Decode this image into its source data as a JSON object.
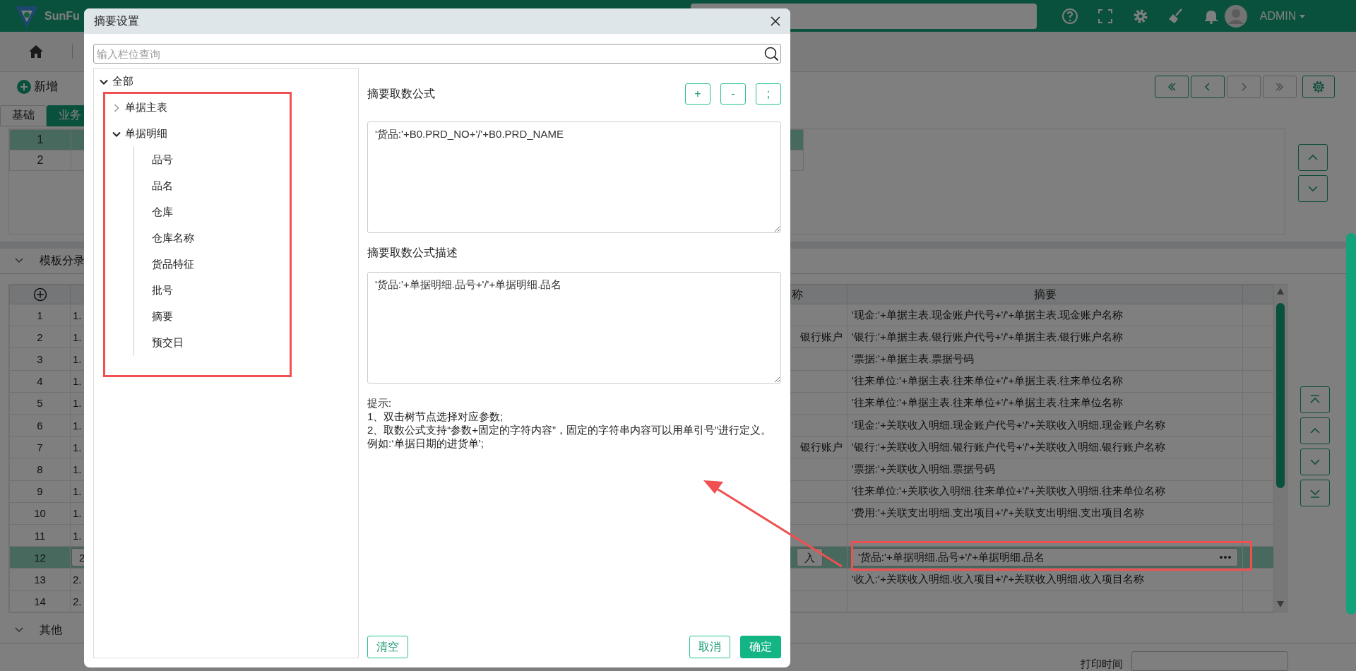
{
  "header": {
    "logo_text": "SunFu",
    "user": "ADMIN"
  },
  "toolbar": {
    "add_button": "新增",
    "pager_buttons": [
      {
        "kind": "first",
        "disabled": false
      },
      {
        "kind": "prev",
        "disabled": false
      },
      {
        "kind": "next",
        "disabled": true
      },
      {
        "kind": "last",
        "disabled": true
      }
    ]
  },
  "tabs": [
    {
      "label": "基础",
      "selected": false
    },
    {
      "label": "业务",
      "selected": true
    }
  ],
  "upper_grid": {
    "rows": [
      {
        "number": "1",
        "selected": true
      },
      {
        "number": "2",
        "selected": false
      }
    ]
  },
  "template_section": {
    "title": "模板分录"
  },
  "entries_table": {
    "columns": [
      "称",
      "摘要"
    ],
    "rows": [
      {
        "number": "1",
        "column_2": "1.",
        "summary": "'现金:'+单据主表.现金账户代号+'/'+单据主表.现金账户名称",
        "selected": false
      },
      {
        "number": "2",
        "column_2": "1.",
        "column_3": "银行账户",
        "summary": "'银行:'+单据主表.银行账户代号+'/'+单据主表.银行账户名称",
        "selected": false
      },
      {
        "number": "3",
        "column_2": "1.",
        "summary": "'票据:'+单据主表.票据号码",
        "selected": false
      },
      {
        "number": "4",
        "column_2": "1.",
        "summary": "'往来单位:'+单据主表.往来单位+'/'+单据主表.往来单位名称",
        "selected": false
      },
      {
        "number": "5",
        "column_2": "1.",
        "summary": "'往来单位:'+单据主表.往来单位+'/'+单据主表.往来单位名称",
        "selected": false
      },
      {
        "number": "6",
        "column_2": "1.",
        "summary": "'现金:'+关联收入明细.现金账户代号+'/'+关联收入明细.现金账户名称",
        "selected": false
      },
      {
        "number": "7",
        "column_2": "1.",
        "column_3": "银行账户",
        "summary": "'银行:'+关联收入明细.银行账户代号+'/'+关联收入明细.银行账户名称",
        "selected": false
      },
      {
        "number": "8",
        "column_2": "1.",
        "summary": "'票据:'+关联收入明细.票据号码",
        "selected": false
      },
      {
        "number": "9",
        "column_2": "1.",
        "summary": "'往来单位:'+关联收入明细.往来单位+'/'+关联收入明细.往来单位名称",
        "selected": false
      },
      {
        "number": "10",
        "column_2": "1.",
        "summary": "'费用:'+关联支出明细.支出项目+'/'+关联支出明细.支出项目名称",
        "selected": false
      },
      {
        "number": "11",
        "column_2": "1.",
        "selected": false
      },
      {
        "number": "12",
        "column_2": "2",
        "column_3": "入",
        "summary": "'货品:'+单据明细.品号+'/'+单据明细.品名",
        "selected": true
      },
      {
        "number": "13",
        "column_2": "2.",
        "summary": "'收入:'+关联收入明细.收入项目+'/'+关联收入明细.收入项目名称",
        "selected": false
      },
      {
        "number": "14",
        "column_2": "2.",
        "selected": false
      }
    ]
  },
  "other_section": {
    "title": "其他"
  },
  "bottom_form": {
    "label": "打印时间"
  },
  "dialog": {
    "title": "摘要设置",
    "search": {
      "placeholder": "输入栏位查询"
    },
    "tree": [
      {
        "label": "全部",
        "expanded": true,
        "children": [
          {
            "label": "单据主表",
            "expanded": false
          },
          {
            "label": "单据明细",
            "expanded": true,
            "children": [
              {
                "label": "品号"
              },
              {
                "label": "品名"
              },
              {
                "label": "仓库"
              },
              {
                "label": "仓库名称"
              },
              {
                "label": "货品特征"
              },
              {
                "label": "批号"
              },
              {
                "label": "摘要"
              },
              {
                "label": "预交日"
              }
            ]
          }
        ]
      }
    ],
    "formula_label": "摘要取数公式",
    "operator_buttons": [
      "+",
      "-",
      ";"
    ],
    "formula": "'货品:'+B0.PRD_NO+'/'+B0.PRD_NAME",
    "description_label": "摘要取数公式描述",
    "description": "'货品:'+单据明细.品号+'/'+单据明细.品名",
    "hint_title": "提示:",
    "hints": [
      "1、双击树节点选择对应参数;",
      "2、取数公式支持“参数+固定的字符内容”，固定的字符串内容可以用单引号”进行定义。例如:‘单据日期的进货单’;"
    ],
    "clear_button": "清空",
    "cancel_button": "取消",
    "ok_button": "确定"
  }
}
